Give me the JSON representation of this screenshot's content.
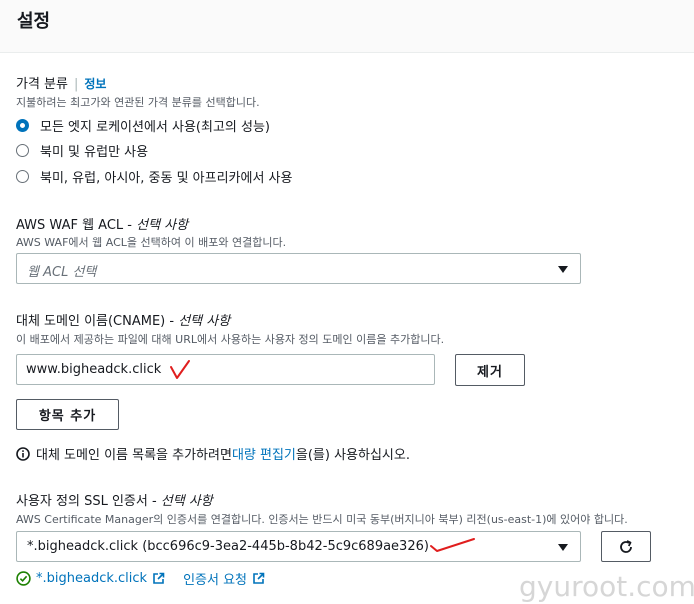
{
  "header": {
    "title": "설정"
  },
  "price_class": {
    "label": "가격 분류",
    "info_link": "정보",
    "description": "지불하려는 최고가와 연관된 가격 분류를 선택합니다.",
    "options": [
      {
        "label": "모든 엣지 로케이션에서 사용(최고의 성능)",
        "selected": true
      },
      {
        "label": "북미 및 유럽만 사용",
        "selected": false
      },
      {
        "label": "북미, 유럽, 아시아, 중동 및 아프리카에서 사용",
        "selected": false
      }
    ]
  },
  "waf": {
    "label": "AWS WAF 웹 ACL - ",
    "optional": "선택 사항",
    "description": "AWS WAF에서 웹 ACL을 선택하여 이 배포와 연결합니다.",
    "placeholder": "웹 ACL 선택"
  },
  "cname": {
    "label": "대체 도메인 이름(CNAME) - ",
    "optional": "선택 사항",
    "description": "이 배포에서 제공하는 파일에 대해 URL에서 사용하는 사용자 정의 도메인 이름을 추가합니다.",
    "value": "www.bigheadck.click",
    "remove_button": "제거",
    "add_button": "항목 추가",
    "note_prefix": "대체 도메인 이름 목록을 추가하려면 ",
    "note_link": "대량 편집기",
    "note_suffix": "을(를) 사용하십시오."
  },
  "ssl": {
    "label": "사용자 정의 SSL 인증서 - ",
    "optional": "선택 사항",
    "description": "AWS Certificate Manager의 인증서를 연결합니다. 인증서는 반드시 미국 동부(버지니아 북부) 리전(us-east-1)에 있어야 합니다.",
    "value": "*.bigheadck.click (bcc696c9-3ea2-445b-8b42-5c9c689ae326)",
    "cert_link": "*.bigheadck.click",
    "request_link": "인증서 요청"
  },
  "watermark": "gyuroot.com",
  "colors": {
    "accent": "#0073bb",
    "success": "#1d8102",
    "annotation": "#e01e1e"
  }
}
